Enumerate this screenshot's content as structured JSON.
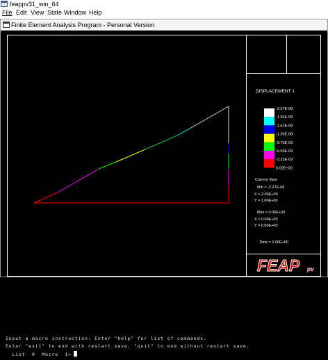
{
  "window": {
    "title": "feappv31_win_64",
    "icon": "feap-app-icon"
  },
  "menu": {
    "items": [
      {
        "label": "File",
        "underline": "F"
      },
      {
        "label": "Edit",
        "underline": "E"
      },
      {
        "label": "View",
        "underline": "V"
      },
      {
        "label": "State",
        "underline": "S"
      },
      {
        "label": "Window",
        "underline": "W"
      },
      {
        "label": "Help",
        "underline": "H"
      }
    ]
  },
  "graphics": {
    "caption": "Finite  Element  Analysis  Program - Personal  Version",
    "background": "#000000",
    "frame_color": "#ffffff"
  },
  "legend": {
    "title": "DISPLACEMENT 1",
    "entries": [
      {
        "label": "-2.27E-08",
        "color": ""
      },
      {
        "label": "-1.95E-08",
        "color": "#ffffff"
      },
      {
        "label": "-1.62E-08",
        "color": "#00ffff"
      },
      {
        "label": "-1.30E-08",
        "color": "#0000ff"
      },
      {
        "label": "-9.75E-09",
        "color": "#ffff00"
      },
      {
        "label": "-6.50E-09",
        "color": "#00ff00"
      },
      {
        "label": "-3.25E-09",
        "color": "#ff00ff"
      },
      {
        "label": "0.00E+00",
        "color": "#ff0000"
      }
    ],
    "current_view": "Current View",
    "min": "Min = -2.27E-08",
    "min_x": "X = 2.00E+00",
    "min_y": "Y = 1.00E+00",
    "max": "Max =  0.00E+00",
    "max_x": "X = 0.00E+00",
    "max_y": "Y = 0.00E+00",
    "time": "Time = 0.00E+00"
  },
  "logo": {
    "text": "FEAP",
    "suffix": "pv",
    "fill_color": "#dd1111",
    "outline_color": "#ffffff"
  },
  "console": {
    "line1": "Input a macro instruction: Enter \"help\" for list of commands.",
    "line2": "Enter \"exit\" to end with restart save, \"quit\" to end without restart save.",
    "prompt": "  List  0  Macro  1>"
  }
}
